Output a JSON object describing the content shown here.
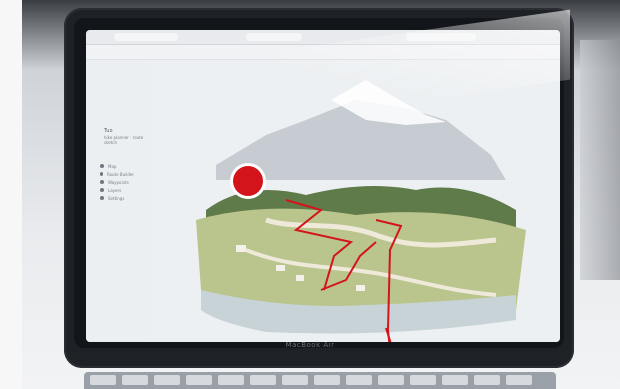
{
  "screen": {
    "brand": "MacBook Air",
    "sidebar": {
      "title": "Tuo",
      "subtitle": "hike planner · route sketch",
      "items": [
        {
          "label": "Map"
        },
        {
          "label": "Route Builder"
        },
        {
          "label": "Waypoints"
        },
        {
          "label": "Layers"
        },
        {
          "label": "Settings"
        }
      ]
    }
  },
  "overlay": {
    "record_color": "#d4141b",
    "sketch_color": "#d4141b"
  }
}
